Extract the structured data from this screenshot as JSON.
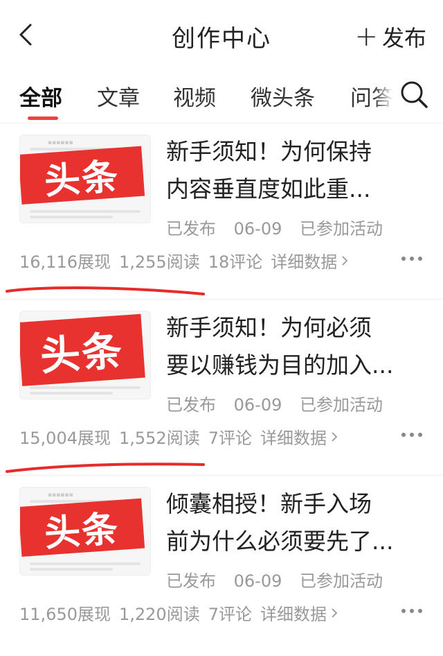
{
  "header": {
    "title": "创作中心",
    "publish_label": "发布"
  },
  "tabs": [
    {
      "label": "全部",
      "active": true
    },
    {
      "label": "文章"
    },
    {
      "label": "视频"
    },
    {
      "label": "微头条"
    },
    {
      "label": "问答"
    }
  ],
  "thumb_text": "头条",
  "accent_color": "#f04142",
  "articles": [
    {
      "title_line1": "新手须知！为何保持",
      "title_line2": "内容垂直度如此重...",
      "status": "已发布",
      "date": "06-09",
      "activity": "已参加活动",
      "impressions": "16,116展现",
      "reads": "1,255阅读",
      "comments": "18评论",
      "detail_label": "详细数据"
    },
    {
      "title_line1": "新手须知！为何必须",
      "title_line2": "要以赚钱为目的加入...",
      "status": "已发布",
      "date": "06-09",
      "activity": "已参加活动",
      "impressions": "15,004展现",
      "reads": "1,552阅读",
      "comments": "7评论",
      "detail_label": "详细数据"
    },
    {
      "title_line1": "倾囊相授！新手入场",
      "title_line2": "前为什么必须要先了...",
      "status": "已发布",
      "date": "06-09",
      "activity": "已参加活动",
      "impressions": "11,650展现",
      "reads": "1,220阅读",
      "comments": "7评论",
      "detail_label": "详细数据"
    }
  ]
}
